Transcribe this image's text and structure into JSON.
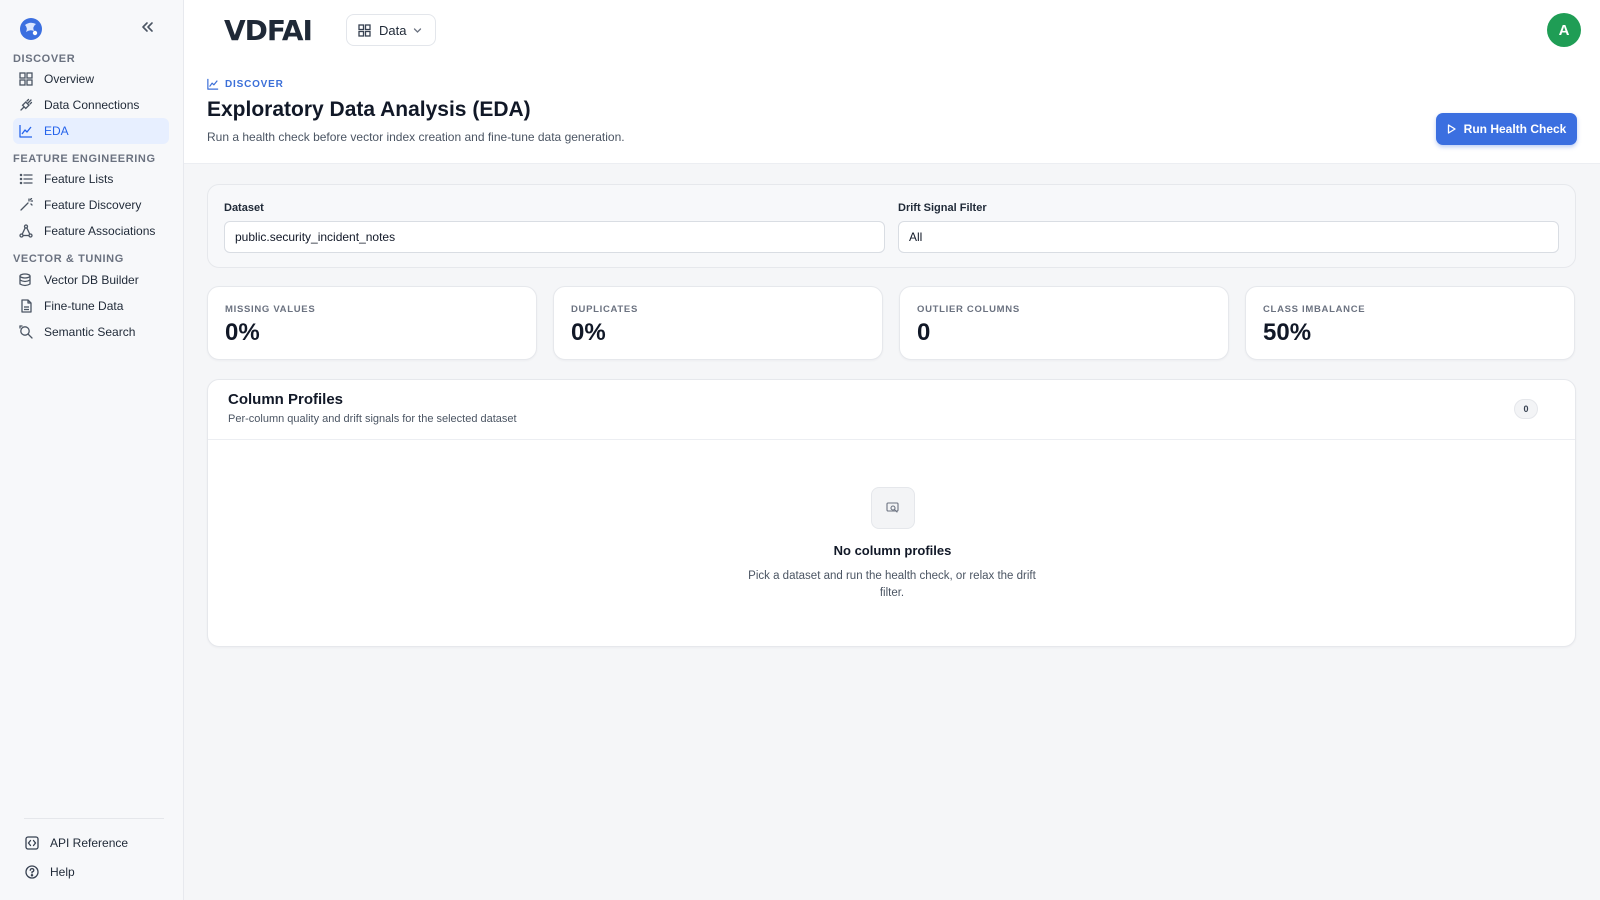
{
  "brand": {
    "name": "VDFAI"
  },
  "sidebar": {
    "sections": [
      {
        "title": "DISCOVER"
      },
      {
        "title": "FEATURE ENGINEERING"
      },
      {
        "title": "VECTOR & TUNING"
      }
    ],
    "items": [
      {
        "label": "Overview",
        "icon": "grid-icon"
      },
      {
        "label": "Data Connections",
        "icon": "plug-icon"
      },
      {
        "label": "EDA",
        "icon": "chart-icon",
        "active": true
      },
      {
        "label": "Feature Lists",
        "icon": "list-icon"
      },
      {
        "label": "Feature Discovery",
        "icon": "wand-icon"
      },
      {
        "label": "Feature Associations",
        "icon": "network-icon"
      },
      {
        "label": "Vector DB Builder",
        "icon": "database-icon"
      },
      {
        "label": "Fine-tune Data",
        "icon": "file-icon"
      },
      {
        "label": "Semantic Search",
        "icon": "search-icon"
      }
    ],
    "footer": [
      {
        "label": "API Reference",
        "icon": "api-icon"
      },
      {
        "label": "Help",
        "icon": "help-icon"
      }
    ]
  },
  "header": {
    "switcher_label": "Data",
    "avatar_initial": "A",
    "breadcrumb": "DISCOVER",
    "title": "Exploratory Data Analysis (EDA)",
    "subtitle": "Run a health check before vector index creation and fine-tune data generation.",
    "run_button": "Run Health Check"
  },
  "filters": {
    "dataset_label": "Dataset",
    "dataset_value": "public.security_incident_notes",
    "drift_label": "Drift Signal Filter",
    "drift_value": "All"
  },
  "stats": [
    {
      "label": "MISSING VALUES",
      "value": "0%"
    },
    {
      "label": "DUPLICATES",
      "value": "0%"
    },
    {
      "label": "OUTLIER COLUMNS",
      "value": "0"
    },
    {
      "label": "CLASS IMBALANCE",
      "value": "50%"
    }
  ],
  "profiles": {
    "title": "Column Profiles",
    "subtitle": "Per-column quality and drift signals for the selected dataset",
    "count": "0",
    "empty_title": "No column profiles",
    "empty_text": "Pick a dataset and run the health check, or relax the drift filter."
  },
  "colors": {
    "accent": "#3b6fe0",
    "avatar": "#1f9d55",
    "active_bg": "#e7efff"
  }
}
